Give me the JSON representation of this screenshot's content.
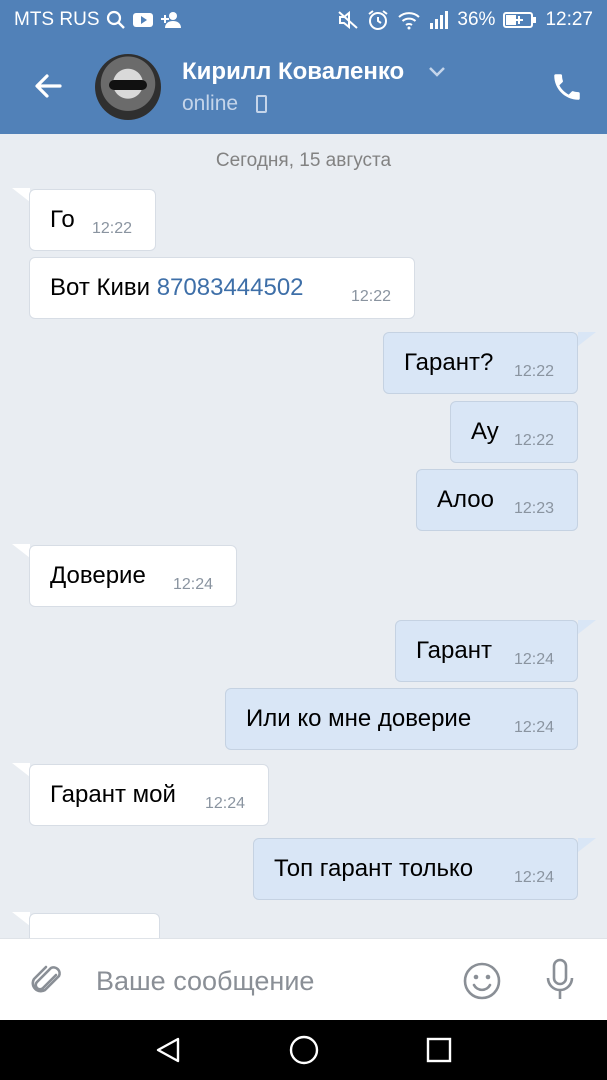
{
  "status_bar": {
    "carrier": "MTS RUS",
    "battery_percent": "36%",
    "time": "12:27",
    "left_icons": [
      "search-icon",
      "youtube-icon",
      "add-friend-icon"
    ],
    "right_icons": [
      "mute-icon",
      "alarm-icon",
      "wifi-icon",
      "signal-icon",
      "battery-charging-icon"
    ]
  },
  "header": {
    "contact_name": "Кирилл Коваленко",
    "status": "online",
    "icons": [
      "back-arrow-icon",
      "chevron-down-icon",
      "mobile-device-icon",
      "phone-icon"
    ]
  },
  "chat": {
    "date_separator": "Сегодня, 15 августа",
    "messages": [
      {
        "direction": "in",
        "text": "Го",
        "time": "12:22"
      },
      {
        "direction": "in",
        "text": "Вот Киви ",
        "link": "87083444502",
        "time": "12:22"
      },
      {
        "direction": "out",
        "text": "Гарант?",
        "time": "12:22"
      },
      {
        "direction": "out",
        "text": "Ау",
        "time": "12:22"
      },
      {
        "direction": "out",
        "text": "Алоо",
        "time": "12:23"
      },
      {
        "direction": "in",
        "text": "Доверие",
        "time": "12:24"
      },
      {
        "direction": "out",
        "text": "Гарант",
        "time": "12:24"
      },
      {
        "direction": "out",
        "text": "Или ко мне доверие",
        "time": "12:24"
      },
      {
        "direction": "in",
        "text": "Гарант мой",
        "time": "12:24"
      },
      {
        "direction": "out",
        "text": "Топ гарант только",
        "time": "12:24"
      }
    ]
  },
  "input_bar": {
    "placeholder": "Ваше сообщение",
    "value": "",
    "icons": [
      "attach-icon",
      "emoji-icon",
      "microphone-icon"
    ]
  },
  "nav_bar": {
    "icons": [
      "nav-back-icon",
      "nav-home-icon",
      "nav-recents-icon"
    ]
  },
  "colors": {
    "header": "#5181b8",
    "incoming_bubble": "#ffffff",
    "outgoing_bubble": "#d9e6f6",
    "link": "#3e6fa8",
    "background": "#e9edf2"
  }
}
